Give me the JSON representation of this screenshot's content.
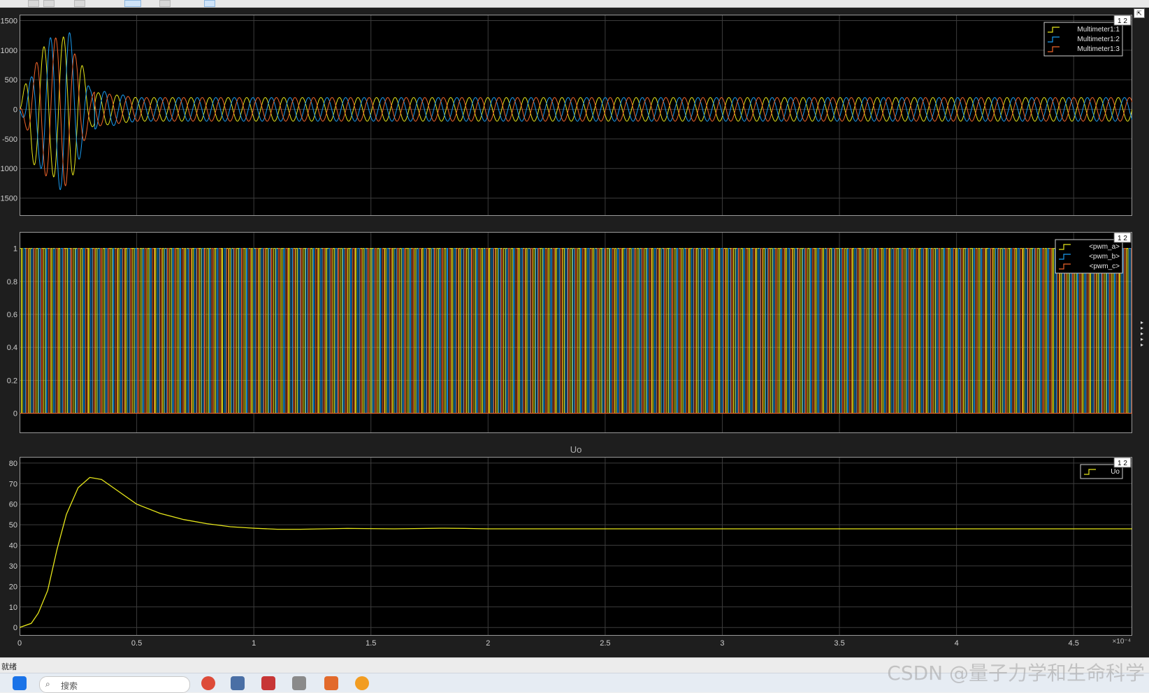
{
  "status": {
    "text": "就绪"
  },
  "taskbar": {
    "search_placeholder": "搜索"
  },
  "watermark": "CSDN @量子力学和生命科学",
  "plots": [
    {
      "title": "",
      "legend": [
        "Multimeter1:1",
        "Multimeter1:2",
        "Multimeter1:3"
      ],
      "badge": "1 2",
      "yticks": [
        "1500",
        "1000",
        "500",
        "0",
        "-500",
        "-1000",
        "-1500"
      ],
      "ylim": [
        -1800,
        1600
      ]
    },
    {
      "title": "",
      "legend": [
        "<pwm_a>",
        "<pwm_b>",
        "<pwm_c>"
      ],
      "badge": "1 2",
      "yticks": [
        "1",
        "0.8",
        "0.6",
        "0.4",
        "0.2",
        "0"
      ],
      "ylim": [
        -0.12,
        1.1
      ]
    },
    {
      "title": "Uo",
      "legend": [
        "Uo"
      ],
      "badge": "1 2",
      "yticks": [
        "80",
        "70",
        "60",
        "50",
        "40",
        "30",
        "20",
        "10",
        "0"
      ],
      "ylim": [
        -4,
        83
      ]
    }
  ],
  "xaxis": {
    "ticks": [
      "0",
      "0.5",
      "1",
      "1.5",
      "2",
      "2.5",
      "3",
      "3.5",
      "4",
      "4.5"
    ],
    "exponent": "×10⁻⁴",
    "xlim": [
      0,
      4.75
    ]
  },
  "colors": {
    "series1": "#e6e61a",
    "series2": "#1a9cf0",
    "series3": "#f0642a",
    "grid": "#3c3c3c",
    "frame": "#9a9a9a"
  },
  "chart_data": [
    {
      "type": "line",
      "title": "",
      "xlabel": "",
      "ylabel": "",
      "x_unit_multiplier": "1e-4",
      "series": [
        {
          "name": "Multimeter1:1",
          "description": "three-phase sinusoid, large transient to ~±1300 for x<0.3, steady amplitude ~200",
          "x": [
            0,
            0.05,
            0.1,
            0.15,
            0.2,
            0.25,
            0.3,
            0.5,
            1,
            2,
            3,
            4,
            4.75
          ],
          "y_envelope": [
            0,
            900,
            1050,
            1150,
            1250,
            1000,
            300,
            200,
            200,
            200,
            200,
            200,
            200
          ]
        },
        {
          "name": "Multimeter1:2",
          "x": [
            0,
            0.1,
            0.2,
            0.3,
            0.5,
            4.75
          ],
          "y_envelope": [
            0,
            1100,
            1450,
            350,
            200,
            200
          ]
        },
        {
          "name": "Multimeter1:3",
          "x": [
            0,
            0.1,
            0.2,
            0.3,
            0.5,
            4.75
          ],
          "y_envelope": [
            0,
            1100,
            1300,
            300,
            200,
            200
          ]
        }
      ],
      "steady_cycles": 60,
      "ylim": [
        -1800,
        1600
      ]
    },
    {
      "type": "line",
      "title": "",
      "series": [
        {
          "name": "<pwm_a>",
          "levels": [
            0,
            1
          ]
        },
        {
          "name": "<pwm_b>",
          "levels": [
            0,
            1
          ]
        },
        {
          "name": "<pwm_c>",
          "levels": [
            0,
            1
          ]
        }
      ],
      "pulse_count": 150,
      "ylim": [
        -0.12,
        1.1
      ]
    },
    {
      "type": "line",
      "title": "Uo",
      "series": [
        {
          "name": "Uo",
          "x": [
            0,
            0.05,
            0.08,
            0.12,
            0.16,
            0.2,
            0.25,
            0.3,
            0.35,
            0.4,
            0.5,
            0.6,
            0.7,
            0.8,
            0.9,
            1.0,
            1.1,
            1.2,
            1.4,
            1.6,
            1.8,
            1.9,
            2.0,
            2.5,
            3.0,
            4.0,
            4.75
          ],
          "y": [
            0,
            2,
            7,
            18,
            38,
            55,
            68,
            73,
            72,
            68,
            60,
            55.5,
            52.5,
            50.5,
            49,
            48.3,
            47.8,
            47.8,
            48.2,
            48.0,
            48.3,
            48.2,
            48.0,
            48.0,
            48.0,
            48.0,
            48.0
          ]
        }
      ],
      "ylim": [
        -4,
        83
      ]
    }
  ]
}
